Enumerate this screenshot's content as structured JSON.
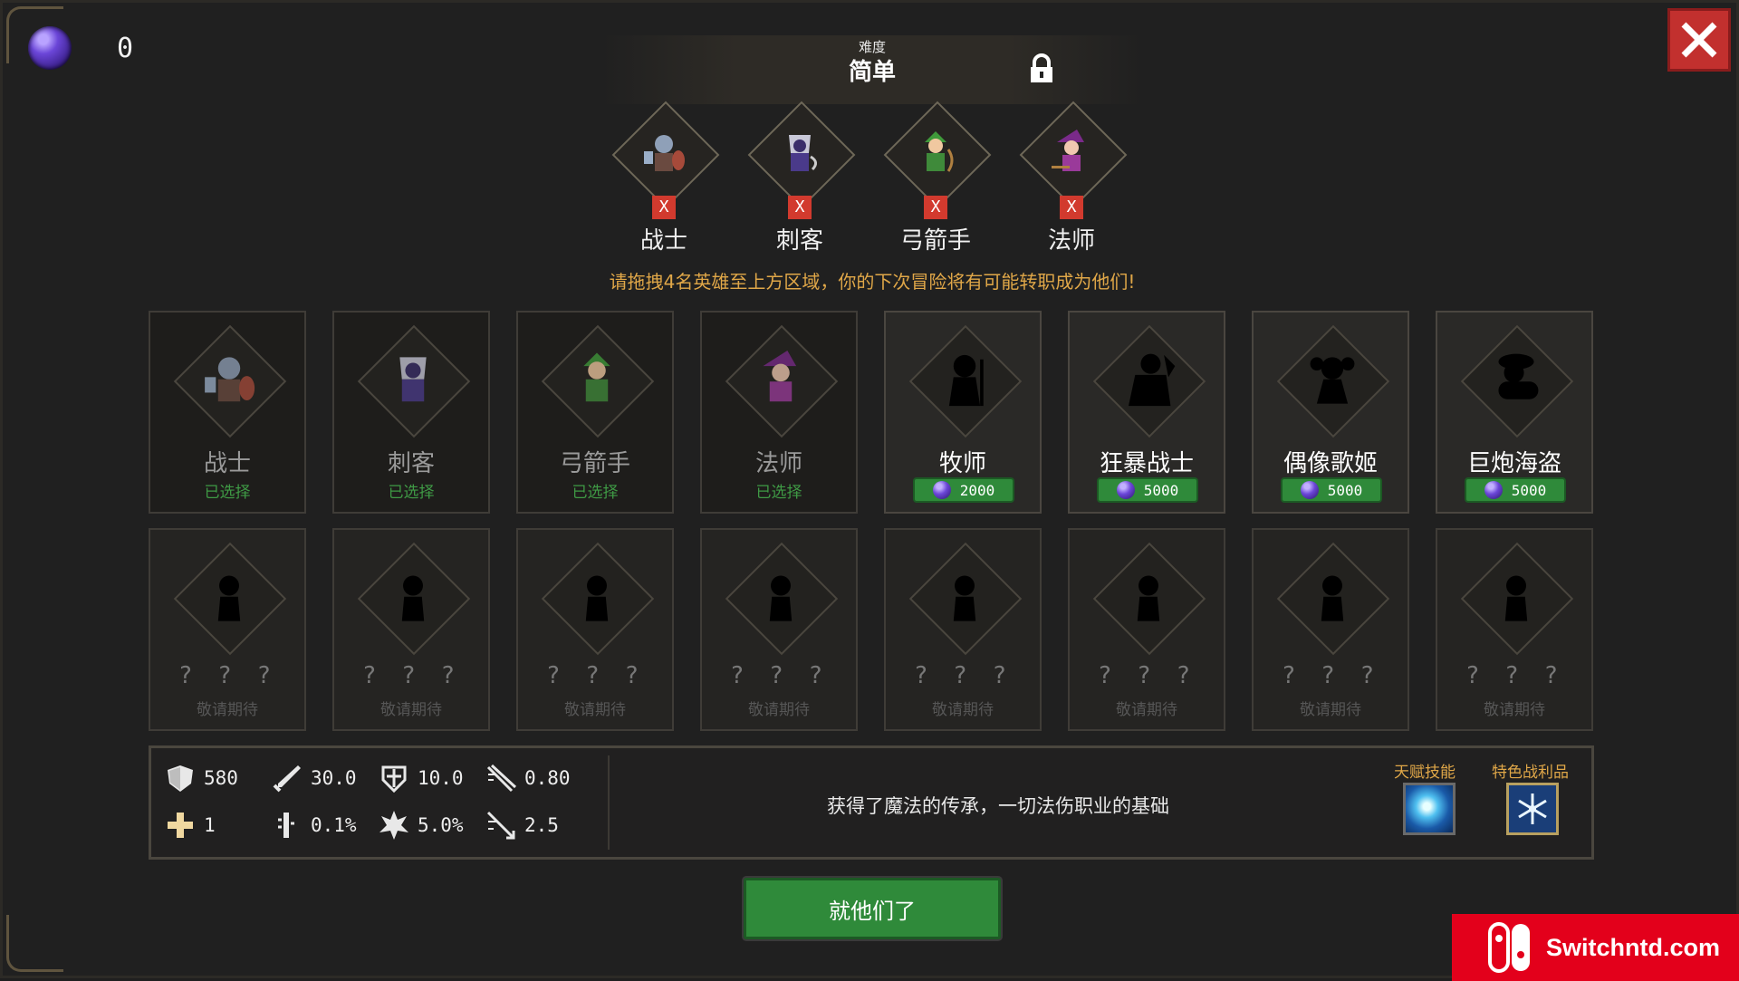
{
  "hud": {
    "gem_count": "0"
  },
  "difficulty": {
    "label": "难度",
    "value": "简单"
  },
  "selected": [
    {
      "name": "战士",
      "remove": "X",
      "icon": "warrior-sprite",
      "color": "#8a5a4a"
    },
    {
      "name": "刺客",
      "remove": "X",
      "icon": "assassin-sprite",
      "color": "#5a4aa0"
    },
    {
      "name": "弓箭手",
      "remove": "X",
      "icon": "archer-sprite",
      "color": "#3f8a3a"
    },
    {
      "name": "法师",
      "remove": "X",
      "icon": "mage-sprite",
      "color": "#9a3a9a"
    }
  ],
  "hint": "请拖拽4名英雄至上方区域，你的下次冒险将有可能转职成为他们!",
  "heroes": [
    {
      "name": "战士",
      "status": "已选择"
    },
    {
      "name": "刺客",
      "status": "已选择"
    },
    {
      "name": "弓箭手",
      "status": "已选择"
    },
    {
      "name": "法师",
      "status": "已选择"
    },
    {
      "name": "牧师",
      "price": "2000"
    },
    {
      "name": "狂暴战士",
      "price": "5000"
    },
    {
      "name": "偶像歌姬",
      "price": "5000"
    },
    {
      "name": "巨炮海盗",
      "price": "5000"
    },
    {
      "name": "? ? ?",
      "status": "敬请期待"
    },
    {
      "name": "? ? ?",
      "status": "敬请期待"
    },
    {
      "name": "? ? ?",
      "status": "敬请期待"
    },
    {
      "name": "? ? ?",
      "status": "敬请期待"
    },
    {
      "name": "? ? ?",
      "status": "敬请期待"
    },
    {
      "name": "? ? ?",
      "status": "敬请期待"
    },
    {
      "name": "? ? ?",
      "status": "敬请期待"
    },
    {
      "name": "? ? ?",
      "status": "敬请期待"
    }
  ],
  "stats": {
    "hp": "580",
    "attack": "30.0",
    "defense": "10.0",
    "attack_speed": "0.80",
    "regen": "1",
    "crit_rate": "0.1%",
    "crit_damage": "5.0%",
    "range": "2.5"
  },
  "description": "获得了魔法的传承，一切法伤职业的基础",
  "talent_label": "天赋技能",
  "loot_label": "特色战利品",
  "confirm_label": "就他们了",
  "watermark": "Switchntd.com"
}
